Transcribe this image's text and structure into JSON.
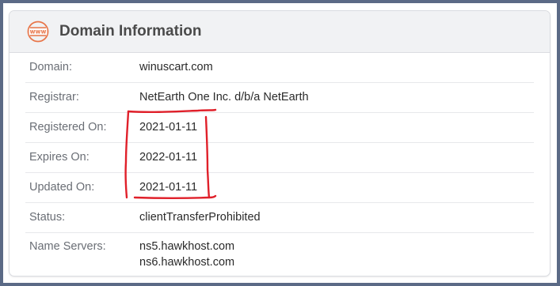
{
  "header": {
    "title": "Domain Information",
    "icon": "www-globe-icon",
    "icon_text": "www",
    "icon_color": "#e8764a"
  },
  "rows": [
    {
      "label": "Domain:",
      "value": "winuscart.com"
    },
    {
      "label": "Registrar:",
      "value": "NetEarth One Inc. d/b/a NetEarth"
    },
    {
      "label": "Registered On:",
      "value": "2021-01-11"
    },
    {
      "label": "Expires On:",
      "value": "2022-01-11"
    },
    {
      "label": "Updated On:",
      "value": "2021-01-11"
    },
    {
      "label": "Status:",
      "value": "clientTransferProhibited"
    }
  ],
  "name_servers": {
    "label": "Name Servers:",
    "values": [
      "ns5.hawkhost.com",
      "ns6.hawkhost.com"
    ]
  },
  "annotation": {
    "color": "#e0202a",
    "shape": "hand-drawn red bracket around dates"
  }
}
